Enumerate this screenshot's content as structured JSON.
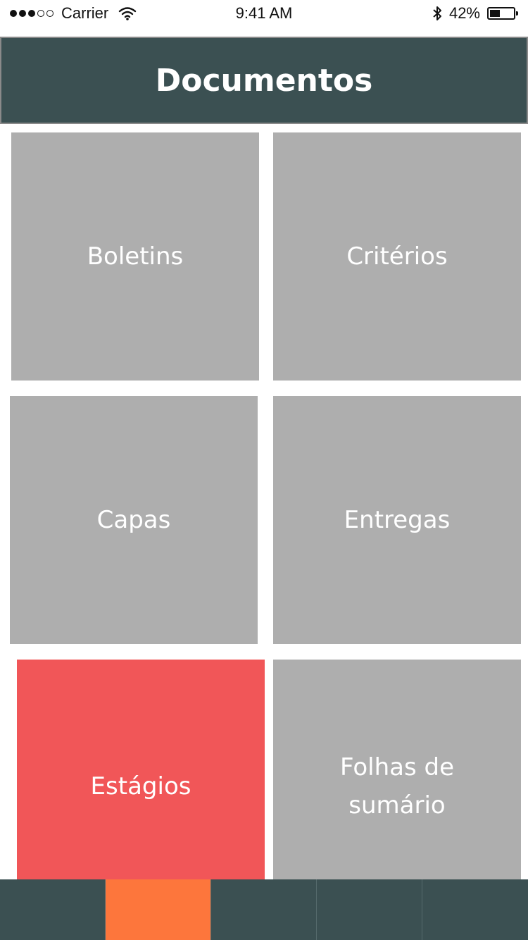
{
  "status_bar": {
    "carrier": "Carrier",
    "time": "9:41 AM",
    "battery": "42%",
    "signal_filled": 3,
    "signal_total": 5,
    "battery_level": 0.42
  },
  "header": {
    "title": "Documentos"
  },
  "tiles": [
    {
      "label": "Boletins",
      "active": false
    },
    {
      "label": "Critérios",
      "active": false
    },
    {
      "label": "Capas",
      "active": false
    },
    {
      "label": "Entregas",
      "active": false
    },
    {
      "label": "Estágios",
      "active": true
    },
    {
      "label": "Folhas de sumário",
      "active": false
    }
  ],
  "tab_bar": {
    "tab_count": 5,
    "active_index": 1
  },
  "colors": {
    "header_bg": "#3b5052",
    "tile_bg": "#aeaeae",
    "tile_active_bg": "#f15658",
    "tab_active_bg": "#fd763c",
    "text_on_tile": "#ffffff"
  }
}
